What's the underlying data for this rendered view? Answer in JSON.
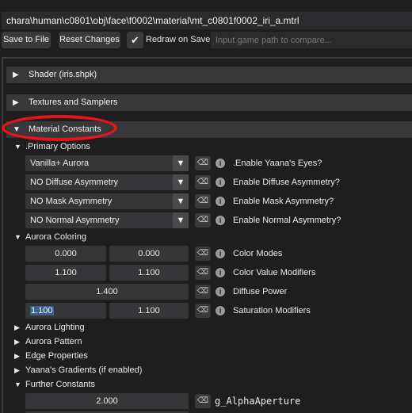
{
  "path": "chara\\human\\c0801\\obj\\face\\f0002\\material\\mt_c0801f0002_iri_a.mtrl",
  "toolbar": {
    "save_label": "Save to File",
    "reset_label": "Reset Changes",
    "redraw_label": "Redraw on Save",
    "redraw_checked": true,
    "compare_placeholder": "Input game path to compare..."
  },
  "sections": {
    "shader": "Shader (iris.shpk)",
    "textures": "Textures and Samplers",
    "material_constants": "Material Constants"
  },
  "primary_options": {
    "label": ".Primary Options",
    "rows": [
      {
        "value": "Vanilla+ Aurora",
        "label": ".Enable Yaana's Eyes?"
      },
      {
        "value": "NO Diffuse Asymmetry",
        "label": "Enable Diffuse Asymmetry?"
      },
      {
        "value": "NO Mask Asymmetry",
        "label": "Enable Mask Asymmetry?"
      },
      {
        "value": "NO Normal Asymmetry",
        "label": "Enable Normal Asymmetry?"
      }
    ]
  },
  "aurora_coloring": {
    "label": "Aurora Coloring",
    "rows": [
      {
        "a": "0.000",
        "b": "0.000",
        "label": "Color Modes"
      },
      {
        "a": "1.100",
        "b": "1.100",
        "label": "Color Value Modifiers"
      },
      {
        "single": "1.400",
        "label": "Diffuse Power"
      },
      {
        "a": "1.100",
        "b": "1.100",
        "label": "Saturation Modifiers"
      }
    ]
  },
  "collapsed_groups": [
    "Aurora Lighting",
    "Aurora Pattern",
    "Edge Properties",
    "Yaana's Gradients (if enabled)"
  ],
  "further_constants": {
    "label": "Further Constants",
    "rows": [
      {
        "single": "2.000",
        "label": "g_AlphaAperture"
      }
    ]
  },
  "icons": {
    "expanded": "triangle-down",
    "collapsed": "triangle-right",
    "clear": "clear-icon",
    "info": "info-icon",
    "check": "check-icon"
  },
  "colors": {
    "highlight_ring": "#e8141b",
    "header_bg": "#38383a",
    "field_bg": "#363638"
  }
}
